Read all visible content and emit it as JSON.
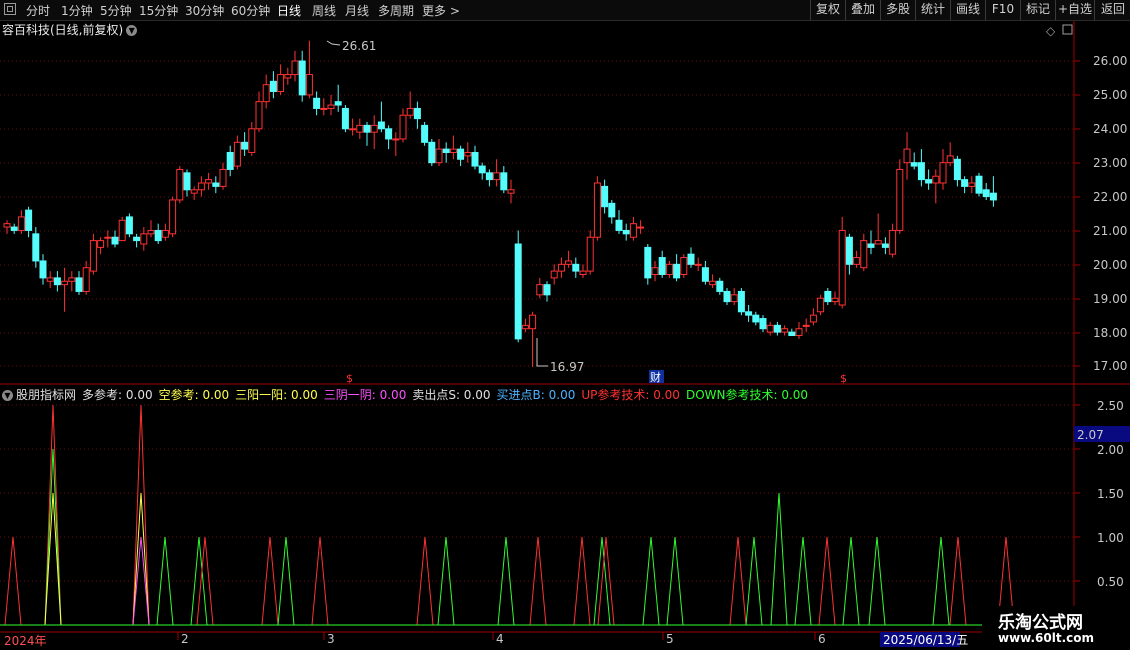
{
  "toolbar": {
    "timeframes": [
      "分时",
      "1分钟",
      "5分钟",
      "15分钟",
      "30分钟",
      "60分钟",
      "日线",
      "周线",
      "月线",
      "多周期",
      "更多 >"
    ],
    "active_timeframe": "日线",
    "right_buttons": [
      "复权",
      "叠加",
      "多股",
      "统计",
      "画线",
      "F10",
      "标记",
      "+自选",
      "返回"
    ]
  },
  "title": "容百科技(日线,前复权)",
  "main_chart": {
    "price_axis": [
      "26.00",
      "25.00",
      "24.00",
      "23.00",
      "22.00",
      "21.00",
      "20.00",
      "19.00",
      "18.00",
      "17.00"
    ],
    "high_label": "26.61",
    "low_label": "16.97",
    "event_markers": [
      "$",
      "财",
      "$"
    ],
    "diamond_icon": "◇",
    "colors": {
      "up": "#ff3232",
      "down": "#54fcfc",
      "grid": "#7a1010",
      "axis": "#a00000"
    }
  },
  "indicator": {
    "name": "股朋指标网",
    "items": [
      {
        "label": "多参考:",
        "value": "0.00",
        "color": "#e0e0e0"
      },
      {
        "label": "空参考:",
        "value": "0.00",
        "color": "#ffff50"
      },
      {
        "label": "三阳一阳:",
        "value": "0.00",
        "color": "#ffff50"
      },
      {
        "label": "三阴一阴:",
        "value": "0.00",
        "color": "#ff50ff"
      },
      {
        "label": "卖出点S:",
        "value": "0.00",
        "color": "#e0e0e0"
      },
      {
        "label": "买进点B:",
        "value": "0.00",
        "color": "#4fb3ff"
      },
      {
        "label": "UP参考技术:",
        "value": "0.00",
        "color": "#ff3232"
      },
      {
        "label": "DOWN参考技术:",
        "value": "0.00",
        "color": "#30ff30"
      }
    ],
    "axis": [
      "2.50",
      "2.00",
      "1.50",
      "1.00",
      "0.50"
    ],
    "cursor_value": "2.07"
  },
  "time_axis": [
    "2024年",
    "2",
    "3",
    "4",
    "5",
    "6"
  ],
  "date_box": "2025/06/13/五",
  "watermark": {
    "line1": "乐淘公式网",
    "line2": "www.60lt.com"
  }
}
